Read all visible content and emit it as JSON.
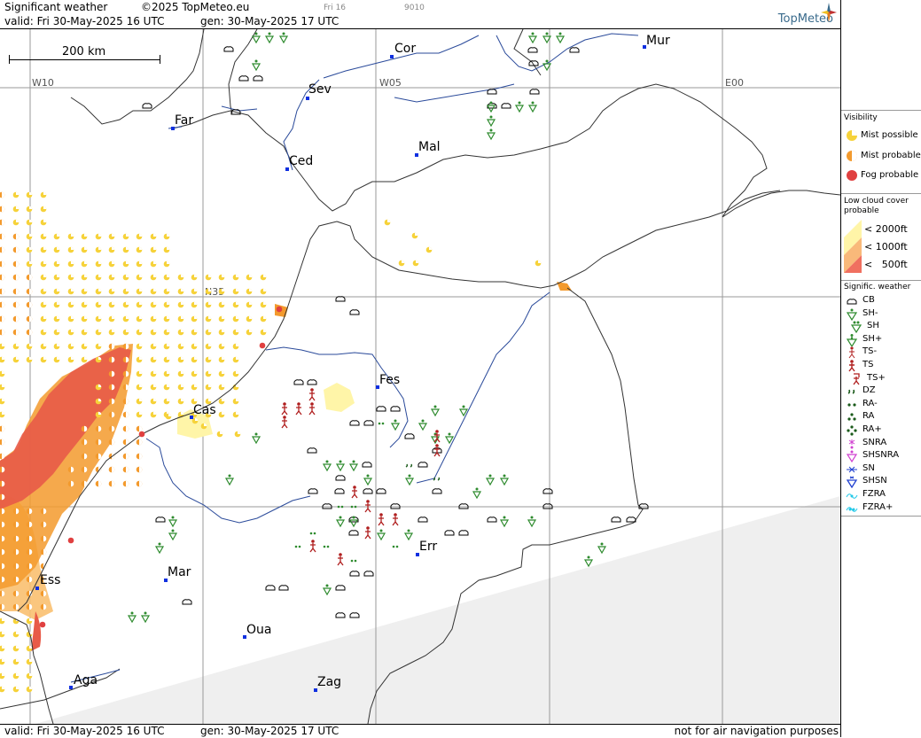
{
  "header": {
    "title": "Significant weather",
    "copyright": "©2025 TopMeteo.eu",
    "small_day": "Fri 16",
    "small_code": "9010",
    "valid": "valid:  Fri  30-May-2025  16 UTC",
    "generated": "gen: 30-May-2025 17 UTC",
    "brand": "TopMeteo"
  },
  "footer": {
    "valid": "valid:  Fri  30-May-2025  16 UTC",
    "generated": "gen: 30-May-2025 17 UTC",
    "disclaimer": "not for air navigation purposes"
  },
  "map": {
    "scale_label": "200 km",
    "grid_labels": [
      "W10",
      "W05",
      "E00",
      "N35"
    ],
    "cities": [
      "Cor",
      "Mur",
      "Sev",
      "Far",
      "Ced",
      "Mal",
      "Fes",
      "Cas",
      "Err",
      "Mar",
      "Ess",
      "Oua",
      "Aga",
      "Zag"
    ]
  },
  "legend": {
    "visibility": {
      "title": "Visibility",
      "items": [
        "Mist possible",
        "Mist probable",
        "Fog probable"
      ]
    },
    "low_cloud": {
      "title": "Low cloud cover probable",
      "items": [
        "< 2000ft",
        "< 1000ft",
        "<   500ft"
      ],
      "colors": [
        "#fff5a8",
        "#f9b97a",
        "#f07060"
      ]
    },
    "sigwx": {
      "title": "Signific. weather",
      "items": [
        "CB",
        "SH-",
        "SH",
        "SH+",
        "TS-",
        "TS",
        "TS+",
        "DZ",
        "RA-",
        "RA",
        "RA+",
        "SNRA",
        "SHSNRA",
        "SN",
        "SHSN",
        "FZRA",
        "FZRA+"
      ]
    }
  },
  "colors": {
    "fog": "#e04040",
    "mist_probable": "#f39a2d",
    "mist_possible": "#f6d23a",
    "shower": "#2e8b2e",
    "thunderstorm": "#b01e1e",
    "snow": "#2040d0",
    "freezing": "#22c8e8",
    "no_data": "#efefef"
  }
}
